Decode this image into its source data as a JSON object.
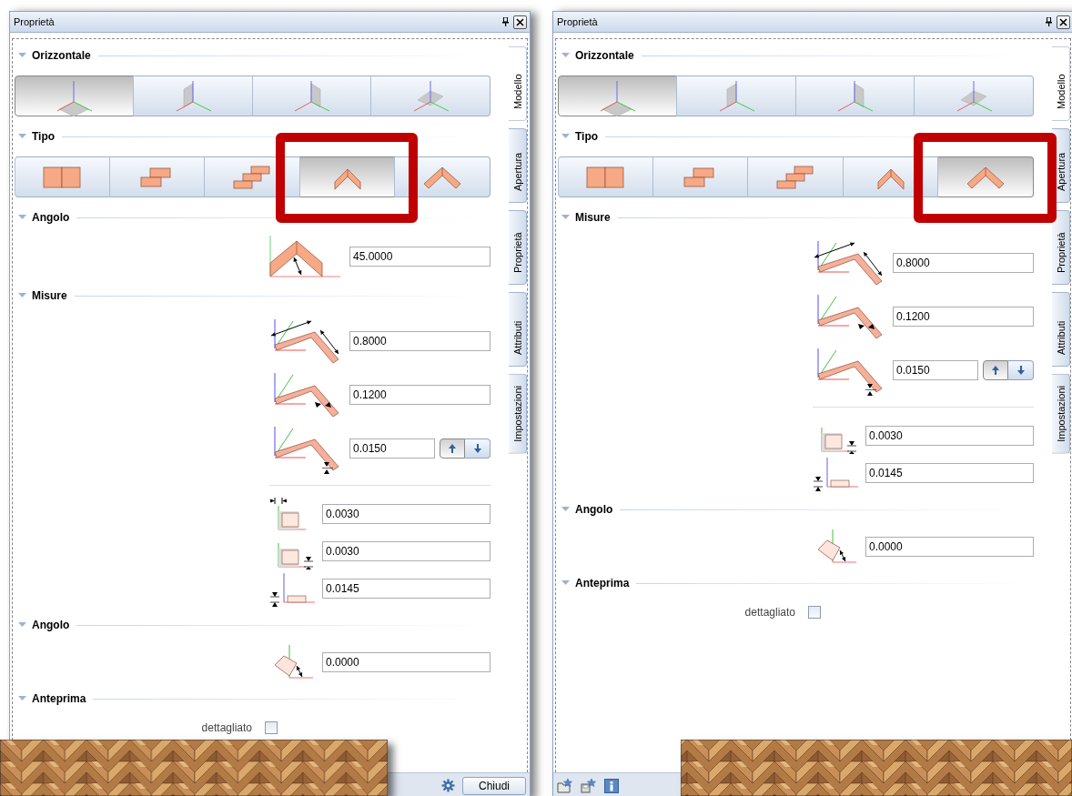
{
  "panels": [
    {
      "title": "Proprietà",
      "side_tabs": [
        {
          "label": "Modello",
          "selected": true
        },
        {
          "label": "Apertura",
          "selected": false
        },
        {
          "label": "Proprietà",
          "selected": false
        },
        {
          "label": "Attributi",
          "selected": false
        },
        {
          "label": "Impostazioni",
          "selected": false
        }
      ],
      "sections": [
        {
          "title": "Orizzontale",
          "kind": "buttons",
          "options": [
            {
              "kind": "plane-xy",
              "selected": true
            },
            {
              "kind": "plane-xz",
              "selected": false
            },
            {
              "kind": "plane-yz",
              "selected": false
            },
            {
              "kind": "plane-tilted",
              "selected": false
            }
          ]
        },
        {
          "title": "Tipo",
          "kind": "buttons",
          "options": [
            {
              "kind": "double-panel",
              "selected": false,
              "highlighted": false
            },
            {
              "kind": "steps-2",
              "selected": false,
              "highlighted": false
            },
            {
              "kind": "steps-3",
              "selected": false,
              "highlighted": false
            },
            {
              "kind": "chevron-tall",
              "selected": true,
              "highlighted": true
            },
            {
              "kind": "chevron-wide",
              "selected": false,
              "highlighted": false
            }
          ]
        },
        {
          "title": "Angolo",
          "kind": "fields",
          "groups": [
            {
              "rows": [
                {
                  "kind": "chevron-angle",
                  "value": "45.0000"
                }
              ]
            }
          ]
        },
        {
          "title": "Misure",
          "kind": "fields",
          "groups": [
            {
              "rows": [
                {
                  "kind": "length",
                  "value": "0.8000"
                },
                {
                  "kind": "width",
                  "value": "0.1200"
                },
                {
                  "kind": "thickness",
                  "value": "0.0150",
                  "stepper": [
                    {
                      "kind": "up",
                      "selected": true
                    },
                    {
                      "kind": "down",
                      "selected": false
                    }
                  ]
                }
              ]
            },
            {
              "rows": [
                {
                  "kind": "offset-side",
                  "value": "0.0030"
                },
                {
                  "kind": "offset-bottom",
                  "value": "0.0030"
                },
                {
                  "kind": "offset-flat",
                  "value": "0.0145"
                }
              ]
            }
          ]
        },
        {
          "title": "Angolo",
          "kind": "fields",
          "groups": [
            {
              "rows": [
                {
                  "kind": "rotation",
                  "value": "0.0000"
                }
              ]
            }
          ]
        },
        {
          "title": "Anteprima",
          "kind": "check",
          "label": "dettagliato",
          "checked": false
        }
      ],
      "footer": {
        "icons": [
          {
            "kind": "gear"
          }
        ],
        "button": "Chiudi"
      }
    },
    {
      "title": "Proprietà",
      "side_tabs": [
        {
          "label": "Modello",
          "selected": true
        },
        {
          "label": "Apertura",
          "selected": false
        },
        {
          "label": "Proprietà",
          "selected": false
        },
        {
          "label": "Attributi",
          "selected": false
        },
        {
          "label": "Impostazioni",
          "selected": false
        }
      ],
      "sections": [
        {
          "title": "Orizzontale",
          "kind": "buttons",
          "options": [
            {
              "kind": "plane-xy",
              "selected": true
            },
            {
              "kind": "plane-xz",
              "selected": false
            },
            {
              "kind": "plane-yz",
              "selected": false
            },
            {
              "kind": "plane-tilted",
              "selected": false
            }
          ]
        },
        {
          "title": "Tipo",
          "kind": "buttons",
          "options": [
            {
              "kind": "double-panel",
              "selected": false,
              "highlighted": false
            },
            {
              "kind": "steps-2",
              "selected": false,
              "highlighted": false
            },
            {
              "kind": "steps-3",
              "selected": false,
              "highlighted": false
            },
            {
              "kind": "chevron-tall",
              "selected": false,
              "highlighted": false
            },
            {
              "kind": "chevron-wide",
              "selected": true,
              "highlighted": true
            }
          ]
        },
        {
          "title": "Misure",
          "kind": "fields",
          "groups": [
            {
              "rows": [
                {
                  "kind": "length",
                  "value": "0.8000"
                },
                {
                  "kind": "width",
                  "value": "0.1200"
                },
                {
                  "kind": "thickness",
                  "value": "0.0150",
                  "stepper": [
                    {
                      "kind": "up",
                      "selected": true
                    },
                    {
                      "kind": "down",
                      "selected": false
                    }
                  ]
                }
              ]
            },
            {
              "rows": [
                {
                  "kind": "offset-bottom",
                  "value": "0.0030"
                },
                {
                  "kind": "offset-flat",
                  "value": "0.0145"
                }
              ]
            }
          ]
        },
        {
          "title": "Angolo",
          "kind": "fields",
          "groups": [
            {
              "rows": [
                {
                  "kind": "rotation",
                  "value": "0.0000"
                }
              ]
            }
          ]
        },
        {
          "title": "Anteprima",
          "kind": "check",
          "label": "dettagliato",
          "checked": false
        }
      ],
      "footer": {
        "icons": [
          {
            "kind": "folder-star"
          },
          {
            "kind": "save-star"
          },
          {
            "kind": "info"
          }
        ]
      }
    }
  ]
}
